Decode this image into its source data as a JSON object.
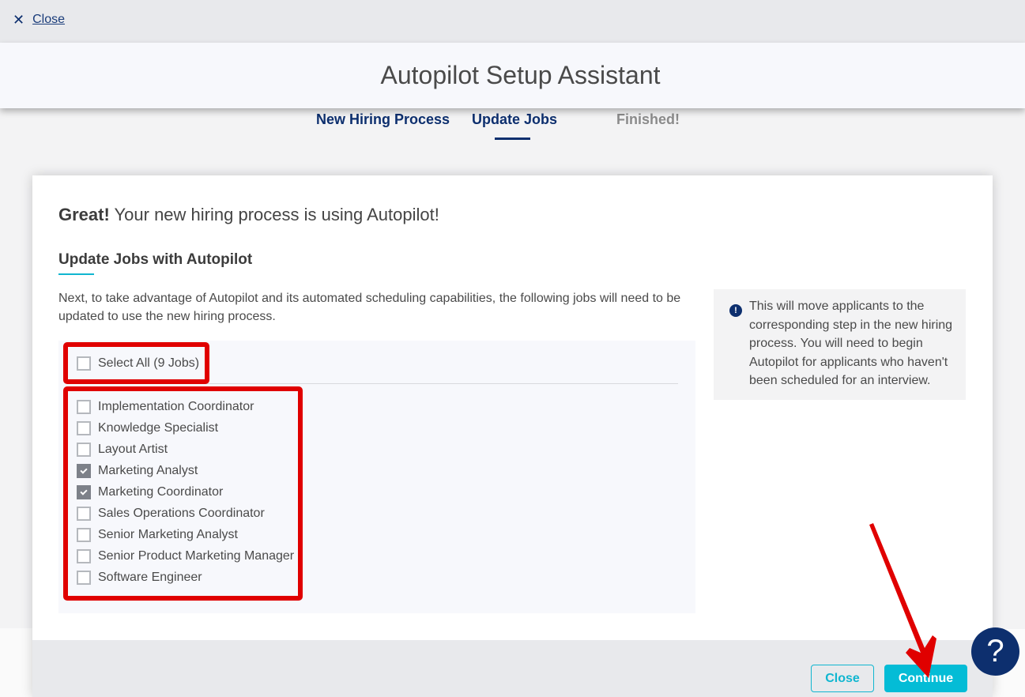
{
  "topbar": {
    "close_label": "Close",
    "close_icon": "x-icon"
  },
  "header": {
    "title": "Autopilot Setup Assistant"
  },
  "steps": [
    {
      "label": "New Hiring Process",
      "state": "completed"
    },
    {
      "label": "Update Jobs",
      "state": "active"
    },
    {
      "label": "Finished!",
      "state": "upcoming"
    }
  ],
  "card": {
    "greeting_bold": "Great!",
    "greeting_rest": " Your new hiring process is using Autopilot!",
    "section_title": "Update Jobs with Autopilot",
    "description": "Next, to take advantage of Autopilot and its automated scheduling capabilities, the following jobs will need to be updated to use the new hiring process.",
    "select_all_label": "Select All (9 Jobs)",
    "select_all_checked": false,
    "jobs": [
      {
        "label": "Implementation Coordinator",
        "checked": false
      },
      {
        "label": "Knowledge Specialist",
        "checked": false
      },
      {
        "label": "Layout Artist",
        "checked": false
      },
      {
        "label": "Marketing Analyst",
        "checked": true
      },
      {
        "label": "Marketing Coordinator",
        "checked": true
      },
      {
        "label": "Sales Operations Coordinator",
        "checked": false
      },
      {
        "label": "Senior Marketing Analyst",
        "checked": false
      },
      {
        "label": "Senior Product Marketing Manager",
        "checked": false
      },
      {
        "label": "Software Engineer",
        "checked": false
      }
    ],
    "info_icon": "exclamation-circle-icon",
    "info_text": "This will move applicants to the corresponding step in the new hiring process. You will need to begin Autopilot for applicants who haven't been scheduled for an interview.",
    "footer": {
      "close_label": "Close",
      "continue_label": "Continue"
    }
  },
  "help": {
    "label": "?"
  },
  "colors": {
    "brand_navy": "#0d2f6e",
    "accent_teal": "#04bcd6",
    "annotation_red": "#e00000"
  }
}
